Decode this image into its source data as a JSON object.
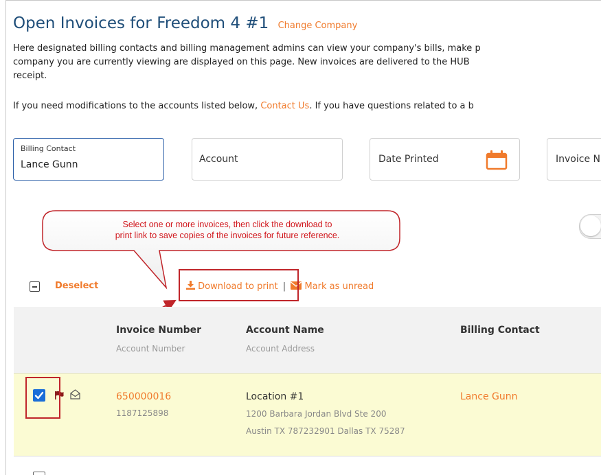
{
  "page": {
    "title": "Open Invoices for Freedom 4 #1",
    "change_company": "Change Company",
    "intro_line1": "Here designated billing contacts and billing management admins can view your company's bills, make p",
    "intro_line2": "company you are currently viewing are displayed on this page. New invoices are delivered to the HUB",
    "intro_line3": "receipt.",
    "intro2_prefix": "If you need modifications to the accounts listed below, ",
    "intro2_link": "Contact Us",
    "intro2_suffix": ". If you have questions related to a b"
  },
  "filters": {
    "billing_contact_label": "Billing Contact",
    "billing_contact_value": "Lance Gunn",
    "account_label": "Account",
    "date_printed_label": "Date Printed",
    "invoice_label": "Invoice N"
  },
  "callout": {
    "line1": "Select one or more invoices, then click the download to",
    "line2": "print link to save copies of the invoices for future reference."
  },
  "toolbar": {
    "deselect": "Deselect",
    "download": "Download to print",
    "separator": "|",
    "mark_unread": "Mark as unread"
  },
  "table": {
    "columns": [
      {
        "title": "Invoice Number",
        "sub": "Account Number"
      },
      {
        "title": "Account Name",
        "sub": "Account Address"
      },
      {
        "title": "Billing Contact",
        "sub": ""
      }
    ],
    "rows": [
      {
        "invoice_number": "650000016",
        "account_number": "1187125898",
        "account_name": "Location #1",
        "address_line1": "1200 Barbara Jordan Blvd Ste 200",
        "address_line2": "Austin TX 787232901 Dallas TX 75287",
        "billing_contact": "Lance Gunn",
        "selected": true
      }
    ]
  },
  "colors": {
    "title": "#1f4e79",
    "accent": "#f07a2b",
    "annotation_red": "#c0252a",
    "row_highlight": "#fbfbd3",
    "checkbox_blue": "#1a6ed8"
  }
}
